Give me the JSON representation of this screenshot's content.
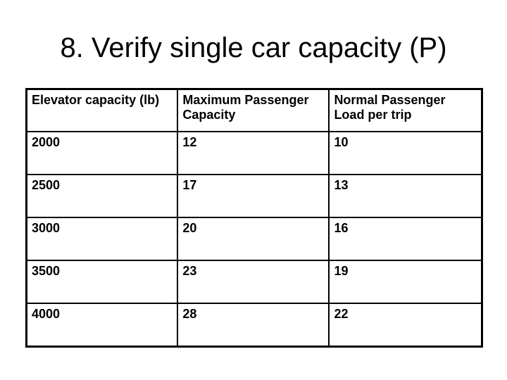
{
  "slide": {
    "title": "8. Verify single car capacity (P)"
  },
  "table": {
    "headers": [
      "Elevator capacity (lb)",
      "Maximum Passenger Capacity",
      "Normal Passenger Load per trip"
    ],
    "rows": [
      [
        "2000",
        "12",
        "10"
      ],
      [
        "2500",
        "17",
        "13"
      ],
      [
        "3000",
        "20",
        "16"
      ],
      [
        "3500",
        "23",
        "19"
      ],
      [
        "4000",
        "28",
        "22"
      ]
    ]
  }
}
